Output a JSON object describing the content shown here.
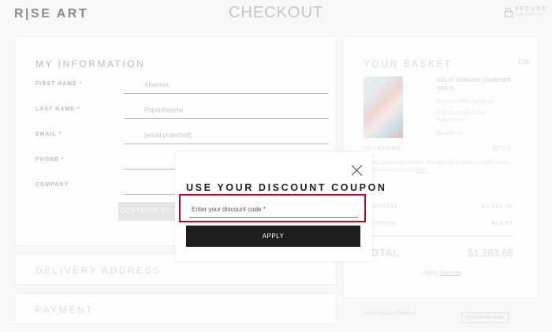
{
  "header": {
    "logo": "R|SE ART",
    "title": "CHECKOUT",
    "secure_label": "SECURE",
    "secure_sub": "CHECKOUT"
  },
  "my_information": {
    "heading": "MY INFORMATION",
    "fields": [
      {
        "label": "FIRST NAME *",
        "value": "Artemiss"
      },
      {
        "label": "LAST NAME *",
        "value": "Poponfrayshe"
      },
      {
        "label": "EMAIL *",
        "value": "[email protected]"
      },
      {
        "label": "PHONE *",
        "value": ""
      },
      {
        "label": "COMPANY",
        "value": ""
      }
    ],
    "continue_label": "CONTINUE TO DELIVERY"
  },
  "delivery": {
    "heading": "DELIVERY ADDRESS"
  },
  "payment": {
    "heading": "PAYMENT"
  },
  "basket": {
    "heading": "YOUR BASKET",
    "edit_label": "Edit",
    "product": {
      "title": "SOLO VERANO (SUMMER ONLY)",
      "artist": "by Luisa Velez Zaragoza",
      "details": "Print 22.8 x 30.3 cm / Rolled Print",
      "price": "$1,195.00"
    },
    "unframed_label": "UNFRAMED",
    "qty_label": "QTY: 1",
    "note_text": "Duties/ Taxes not included. Charges Upon Delivery. Learn more about this topic, check",
    "note_link": "here",
    "subtotal_label": "SUBTOTAL",
    "subtotal_value": "$1,195.00",
    "shipping_label": "SHIPPING",
    "shipping_value": "$88.68",
    "total_label": "TOTAL",
    "total_value": "$1,283.68",
    "apply_discount_prefix": "+ Apply",
    "apply_discount_link": "Discount",
    "safe_text": "Safe & Secure Checkout",
    "stripe_label": "Powered by stripe"
  },
  "modal": {
    "heading": "USE YOUR DISCOUNT COUPON",
    "input_placeholder": "Enter your discount code *",
    "apply_label": "APPLY",
    "highlight_color": "#d0021b"
  }
}
